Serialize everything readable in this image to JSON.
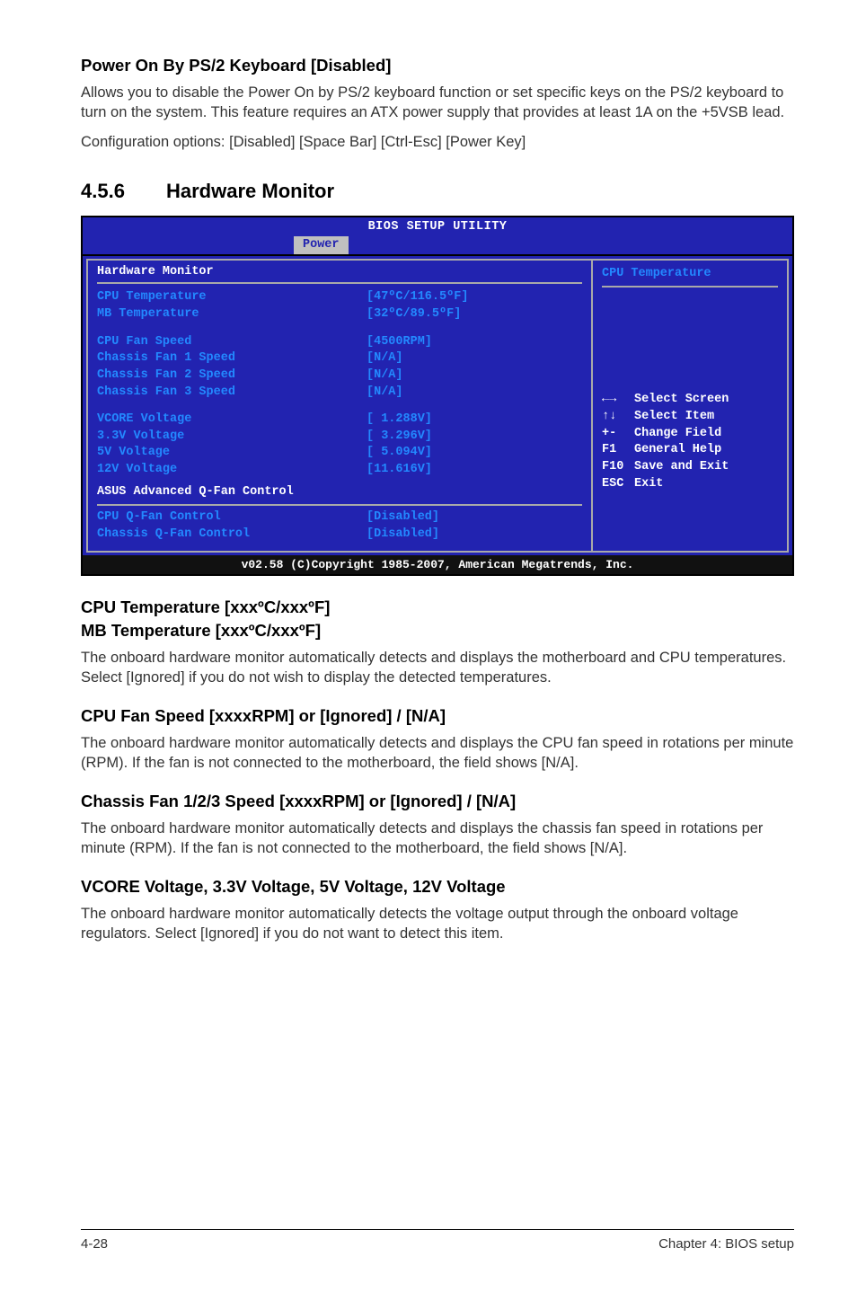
{
  "section1": {
    "heading": "Power On By PS/2 Keyboard [Disabled]",
    "p1": "Allows you to disable the Power On by PS/2 keyboard function or set specific keys on the PS/2 keyboard to turn on the system. This feature requires an ATX power supply that provides at least 1A on the +5VSB lead.",
    "p2": "Configuration options: [Disabled] [Space Bar] [Ctrl-Esc] [Power Key]"
  },
  "hwmon": {
    "section_number": "4.5.6",
    "section_title": "Hardware Monitor"
  },
  "bios": {
    "title": "BIOS SETUP UTILITY",
    "tab": "Power",
    "panel_title": "Hardware Monitor",
    "rows": {
      "cpu_temp_l": "CPU Temperature",
      "cpu_temp_v": "[47ºC/116.5ºF]",
      "mb_temp_l": "MB Temperature",
      "mb_temp_v": "[32ºC/89.5ºF]",
      "cpu_fan_l": "CPU Fan Speed",
      "cpu_fan_v": "[4500RPM]",
      "ch1_l": "Chassis Fan 1 Speed",
      "ch1_v": "[N/A]",
      "ch2_l": "Chassis Fan 2 Speed",
      "ch2_v": "[N/A]",
      "ch3_l": "Chassis Fan 3 Speed",
      "ch3_v": "[N/A]",
      "vcore_l": "VCORE Voltage",
      "vcore_v": "[ 1.288V]",
      "v33_l": "3.3V  Voltage",
      "v33_v": "[ 3.296V]",
      "v5_l": "5V    Voltage",
      "v5_v": "[ 5.094V]",
      "v12_l": "12V   Voltage",
      "v12_v": "[11.616V]",
      "adv_l": "ASUS Advanced Q-Fan Control",
      "cpuq_l": "CPU Q-Fan Control",
      "cpuq_v": "[Disabled]",
      "chq_l": "Chassis Q-Fan Control",
      "chq_v": "[Disabled]"
    },
    "help": {
      "top": "CPU Temperature",
      "l1_icon": "←→",
      "l1": "Select Screen",
      "l2_icon": "↑↓",
      "l2": "Select Item",
      "l3_icon": "+-",
      "l3": "Change Field",
      "l4_icon": "F1",
      "l4": "General Help",
      "l5_icon": "F10",
      "l5": "Save and Exit",
      "l6_icon": "ESC",
      "l6": "Exit"
    },
    "footer": "v02.58 (C)Copyright 1985-2007, American Megatrends, Inc."
  },
  "cpu_temp_sec": {
    "h1": "CPU Temperature [xxxºC/xxxºF]",
    "h2": "MB Temperature [xxxºC/xxxºF]",
    "p": "The onboard hardware monitor automatically detects and displays the motherboard and CPU temperatures. Select [Ignored] if you do not wish to display the detected temperatures."
  },
  "cpu_fan_sec": {
    "h": "CPU Fan Speed [xxxxRPM] or [Ignored] / [N/A]",
    "p": "The onboard hardware monitor automatically detects and displays the CPU fan speed in rotations per minute (RPM). If the fan is not connected to the motherboard, the field shows [N/A]."
  },
  "chassis_sec": {
    "h": "Chassis Fan 1/2/3 Speed [xxxxRPM] or [Ignored] / [N/A]",
    "p": "The onboard hardware monitor automatically detects and displays the chassis fan speed in rotations per minute (RPM). If the fan is not connected to the motherboard, the field shows [N/A]."
  },
  "vcore_sec": {
    "h": "VCORE Voltage, 3.3V Voltage, 5V Voltage, 12V Voltage",
    "p": "The onboard hardware monitor automatically detects the voltage output through the onboard voltage regulators. Select [Ignored] if you do not want to detect this item."
  },
  "footer": {
    "left": "4-28",
    "right": "Chapter 4: BIOS setup"
  }
}
